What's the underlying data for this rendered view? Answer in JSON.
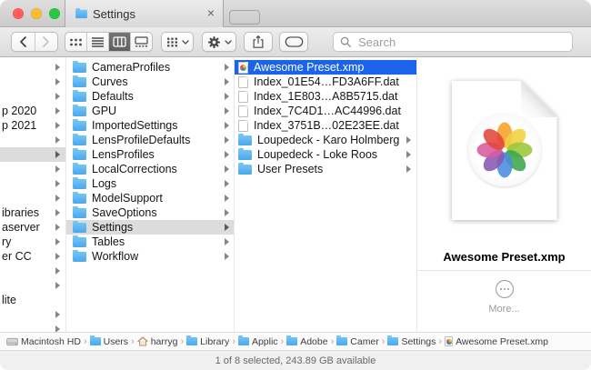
{
  "colors": {
    "selection_blue": "#1b63e9",
    "folder_top": "#72c4f6",
    "folder_bottom": "#4ba7ea",
    "traffic_red": "#ff5f57",
    "traffic_yellow": "#febc2e",
    "traffic_green": "#28c840",
    "petals": [
      "#f5a228",
      "#f0d23c",
      "#9cc63e",
      "#3ca64a",
      "#4a8ce0",
      "#8a57b0",
      "#d85a9e",
      "#e2453a"
    ]
  },
  "titlebar": {
    "tab_label": "Settings",
    "close_glyph": "×"
  },
  "toolbar": {
    "search_placeholder": "Search"
  },
  "browser": {
    "left_column_partial": {
      "rows": [
        {
          "text": "",
          "arrow": true,
          "highlighted": false
        },
        {
          "text": "",
          "arrow": true,
          "highlighted": false
        },
        {
          "text": "",
          "arrow": true,
          "highlighted": false
        },
        {
          "text": "p 2020",
          "arrow": true,
          "highlighted": false
        },
        {
          "text": "p 2021",
          "arrow": true,
          "highlighted": false
        },
        {
          "text": "",
          "arrow": true,
          "highlighted": false
        },
        {
          "text": "",
          "arrow": true,
          "highlighted": true
        },
        {
          "text": "",
          "arrow": true,
          "highlighted": false
        },
        {
          "text": "",
          "arrow": true,
          "highlighted": false
        },
        {
          "text": "",
          "arrow": true,
          "highlighted": false
        },
        {
          "text": "ibraries",
          "arrow": true,
          "highlighted": false
        },
        {
          "text": "aserver",
          "arrow": true,
          "highlighted": false
        },
        {
          "text": "ry",
          "arrow": true,
          "highlighted": false
        },
        {
          "text": "er CC",
          "arrow": true,
          "highlighted": false
        },
        {
          "text": "",
          "arrow": true,
          "highlighted": false
        },
        {
          "text": "",
          "arrow": true,
          "highlighted": false
        },
        {
          "text": "lite",
          "arrow": false,
          "highlighted": false
        },
        {
          "text": "",
          "arrow": true,
          "highlighted": false
        },
        {
          "text": "",
          "arrow": true,
          "highlighted": false
        }
      ]
    },
    "folders_column": {
      "selected_index": 11,
      "items": [
        "CameraProfiles",
        "Curves",
        "Defaults",
        "GPU",
        "ImportedSettings",
        "LensProfileDefaults",
        "LensProfiles",
        "LocalCorrections",
        "Logs",
        "ModelSupport",
        "SaveOptions",
        "Settings",
        "Tables",
        "Workflow"
      ]
    },
    "files_column": {
      "items": [
        {
          "name": "Awesome Preset.xmp",
          "kind": "xmp",
          "selected": true,
          "arrow": false
        },
        {
          "name": "Index_01E54…FD3A6FF.dat",
          "kind": "doc",
          "selected": false,
          "arrow": false
        },
        {
          "name": "Index_1E803…A8B5715.dat",
          "kind": "doc",
          "selected": false,
          "arrow": false
        },
        {
          "name": "Index_7C4D1…AC44996.dat",
          "kind": "doc",
          "selected": false,
          "arrow": false
        },
        {
          "name": "Index_3751B…02E23EE.dat",
          "kind": "doc",
          "selected": false,
          "arrow": false
        },
        {
          "name": "Loupedeck - Karo Holmberg",
          "kind": "folder",
          "selected": false,
          "arrow": true
        },
        {
          "name": "Loupedeck - Loke Roos",
          "kind": "folder",
          "selected": false,
          "arrow": true
        },
        {
          "name": "User Presets",
          "kind": "folder",
          "selected": false,
          "arrow": true
        }
      ]
    }
  },
  "preview": {
    "filename": "Awesome Preset.xmp",
    "more_label": "More..."
  },
  "pathbar": {
    "separator": "›",
    "items": [
      {
        "label": "Macintosh HD",
        "icon": "hdd"
      },
      {
        "label": "Users",
        "icon": "folder-users"
      },
      {
        "label": "harryg",
        "icon": "home"
      },
      {
        "label": "Library",
        "icon": "folder"
      },
      {
        "label": "Applic",
        "icon": "folder"
      },
      {
        "label": "Adobe",
        "icon": "folder"
      },
      {
        "label": "Camer",
        "icon": "folder"
      },
      {
        "label": "Settings",
        "icon": "folder"
      },
      {
        "label": "Awesome Preset.xmp",
        "icon": "xmp"
      }
    ]
  },
  "statusbar": {
    "text": "1 of 8 selected, 243.89 GB available"
  }
}
